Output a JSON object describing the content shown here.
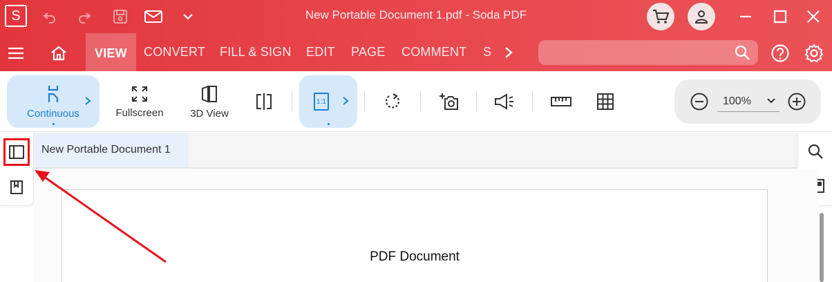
{
  "window": {
    "title": "New Portable Document 1.pdf   -   Soda PDF",
    "logo_letter": "S"
  },
  "menu": {
    "tabs": [
      {
        "label": "VIEW"
      },
      {
        "label": "CONVERT"
      },
      {
        "label": "FILL & SIGN"
      },
      {
        "label": "EDIT"
      },
      {
        "label": "PAGE"
      },
      {
        "label": "COMMENT"
      },
      {
        "label": "S"
      }
    ],
    "search_placeholder": ""
  },
  "toolbar": {
    "continuous_label": "Continuous",
    "fullscreen_label": "Fullscreen",
    "view3d_label": "3D View",
    "actual_size_label": "1:1"
  },
  "zoom": {
    "value": "100%"
  },
  "document": {
    "tab_label": "New Portable Document 1",
    "page_text": "PDF Document"
  },
  "colors": {
    "brand_red": "#e2363e",
    "selected_blue": "#d6e9fb",
    "annotation_red": "#e8121a"
  }
}
